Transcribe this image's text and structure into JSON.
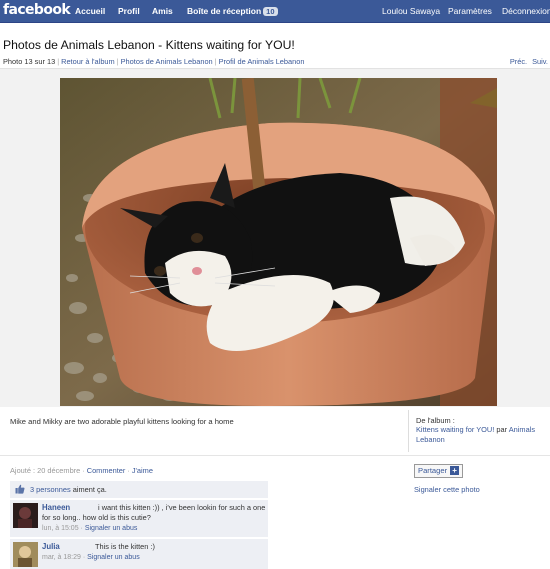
{
  "topbar": {
    "logo": "facebook",
    "nav": [
      "Accueil",
      "Profil",
      "Amis"
    ],
    "inbox_label": "Boîte de réception",
    "inbox_count": "10",
    "user": "Loulou Sawaya",
    "settings": "Paramètres",
    "logout": "Déconnexion"
  },
  "page": {
    "title": "Photos de Animals Lebanon - Kittens waiting for YOU!",
    "photo_counter": "Photo 13 sur 13",
    "crumbs": [
      "Retour à l'album",
      "Photos de Animals Lebanon",
      "Profil de Animals Lebanon"
    ],
    "prev": "Préc.",
    "next": "Suiv."
  },
  "photo": {
    "caption": "Mike and Mikky are two adorable playful kittens looking for a home"
  },
  "album": {
    "label": "De l'album :",
    "name": "Kittens waiting for YOU!",
    "by": "par",
    "owner": "Animals Lebanon"
  },
  "meta": {
    "added": "Ajouté : 20 décembre",
    "comment_link": "Commenter",
    "like_link": "J'aime"
  },
  "likes": {
    "count_link": "3 personnes",
    "text": "aiment ça."
  },
  "comments": [
    {
      "name": "Haneen",
      "text": "i want this kitten :)) , i've been lookin for such a one for so long.. how old is this cutie?",
      "time": "lun, à 15:05",
      "report": "Signaler un abus"
    },
    {
      "name": "Julia",
      "text": "This is the kitten :)",
      "time": "mar, à 18:29",
      "report": "Signaler un abus"
    }
  ],
  "actions": {
    "share": "Partager",
    "report_photo": "Signaler cette photo"
  },
  "colors": {
    "brand": "#3b5998",
    "light_panel": "#edeff4"
  }
}
